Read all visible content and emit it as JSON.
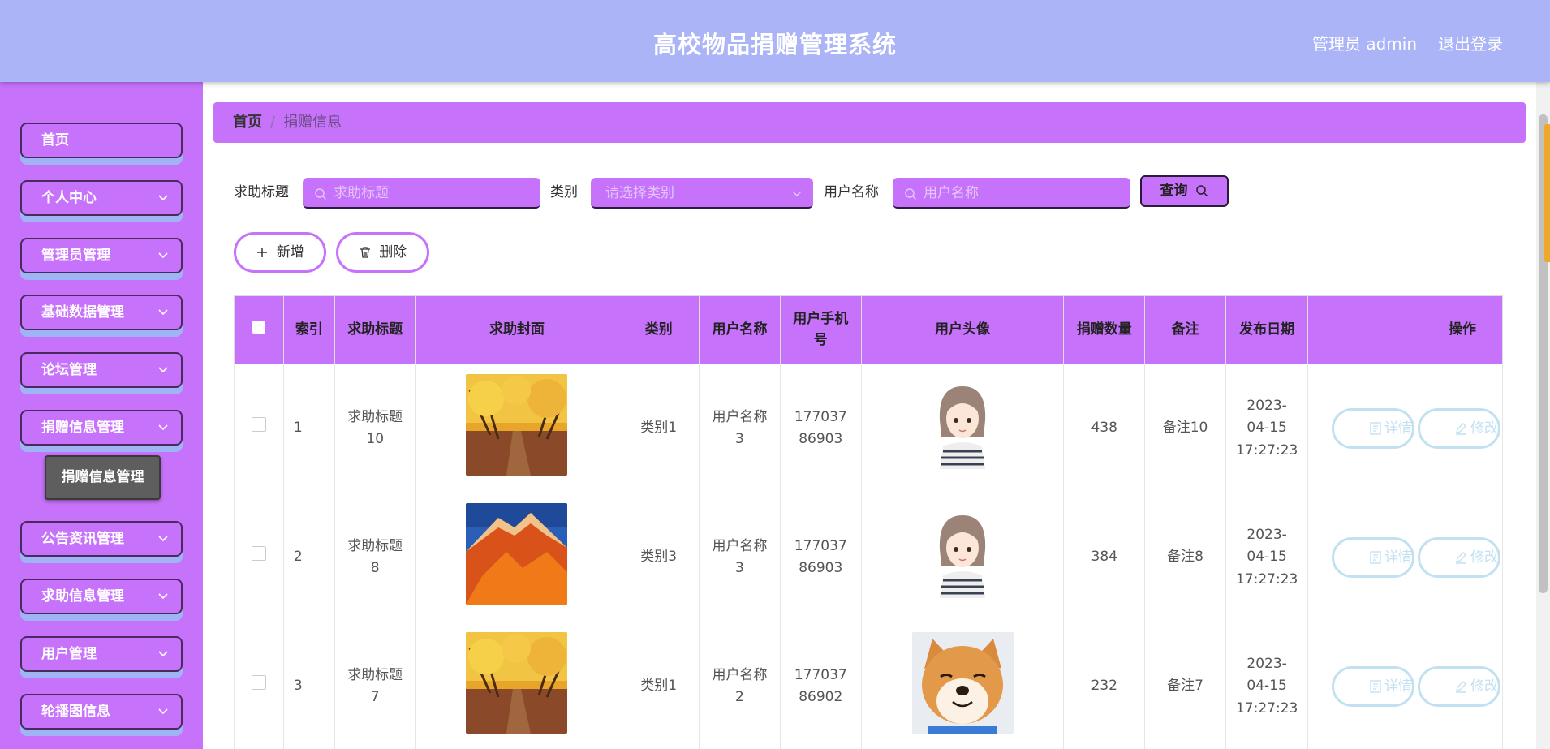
{
  "header": {
    "title": "高校物品捐赠管理系统",
    "user": "管理员 admin",
    "logout": "退出登录"
  },
  "sidebar": {
    "items": [
      {
        "label": "首页"
      },
      {
        "label": "个人中心"
      },
      {
        "label": "管理员管理"
      },
      {
        "label": "基础数据管理"
      },
      {
        "label": "论坛管理"
      },
      {
        "label": "捐赠信息管理"
      },
      {
        "label": "公告资讯管理"
      },
      {
        "label": "求助信息管理"
      },
      {
        "label": "用户管理"
      },
      {
        "label": "轮播图信息"
      }
    ],
    "submenu": "捐赠信息管理"
  },
  "breadcrumb": {
    "home": "首页",
    "separator": "/",
    "current": "捐赠信息"
  },
  "search": {
    "title_label": "求助标题",
    "title_placeholder": "求助标题",
    "category_label": "类别",
    "category_placeholder": "请选择类别",
    "username_label": "用户名称",
    "username_placeholder": "用户名称",
    "query_button": "查询"
  },
  "actions": {
    "add": "新增",
    "delete": "删除"
  },
  "table": {
    "headers": [
      "索引",
      "求助标题",
      "求助封面",
      "类别",
      "用户名称",
      "用户手机号",
      "用户头像",
      "捐赠数量",
      "备注",
      "发布日期",
      "操作"
    ],
    "rows": [
      {
        "index": "1",
        "title": "求助标题10",
        "category": "类别1",
        "username": "用户名称3",
        "phone": "17703786903",
        "count": "438",
        "note": "备注10",
        "date": "2023-04-15 17:27:23",
        "cover": "autumn-avenue",
        "avatar": "girl"
      },
      {
        "index": "2",
        "title": "求助标题8",
        "category": "类别3",
        "username": "用户名称3",
        "phone": "17703786903",
        "count": "384",
        "note": "备注8",
        "date": "2023-04-15 17:27:23",
        "cover": "red-mountain",
        "avatar": "girl"
      },
      {
        "index": "3",
        "title": "求助标题7",
        "category": "类别1",
        "username": "用户名称2",
        "phone": "17703786902",
        "count": "232",
        "note": "备注7",
        "date": "2023-04-15 17:27:23",
        "cover": "autumn-avenue",
        "avatar": "shiba-dog"
      }
    ],
    "detail_button": "详情",
    "edit_button": "修改"
  },
  "colors": {
    "header_bg": "#aab4f6",
    "sidebar_bg": "#c772fb",
    "accent": "#c772fb",
    "menu_shadow": "#9fb4f4",
    "op_button": "#c2e1f0"
  }
}
